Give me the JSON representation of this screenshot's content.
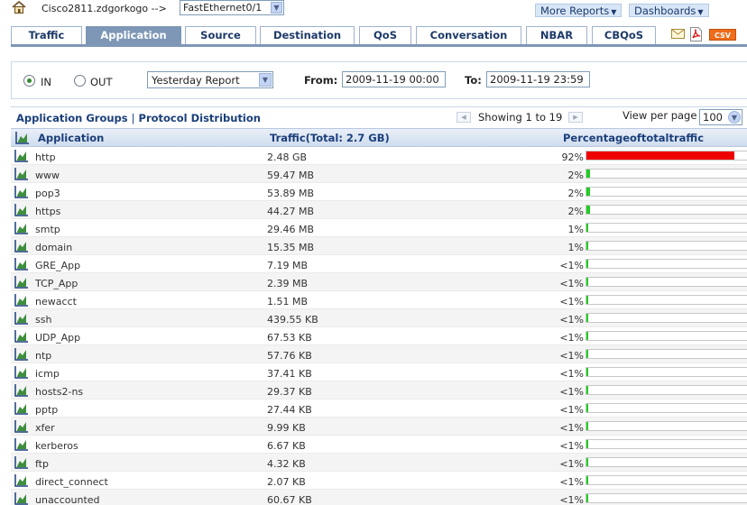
{
  "topbar": {
    "device": "Cisco2811.zdgorkogo -->",
    "interface": "FastEthernet0/1",
    "more_reports": "More Reports",
    "dashboards": "Dashboards"
  },
  "tabs": [
    "Traffic",
    "Application",
    "Source",
    "Destination",
    "QoS",
    "Conversation",
    "NBAR",
    "CBQoS"
  ],
  "active_tab": "Application",
  "export": {
    "csv_label": "CSV"
  },
  "filter": {
    "in_label": "IN",
    "out_label": "OUT",
    "selected_direction": "IN",
    "report": "Yesterday Report",
    "from_label": "From:",
    "from_value": "2009-11-19 00:00",
    "to_label": "To:",
    "to_value": "2009-11-19 23:59"
  },
  "grid": {
    "group_link_1": "Application Groups",
    "group_sep": "|",
    "group_link_2": "Protocol Distribution",
    "showing": "Showing 1 to 19",
    "view_per_page_label": "View per page",
    "view_per_page": "100",
    "col_application": "Application",
    "col_traffic": "Traffic(Total: 2.7 GB)",
    "col_percentage": "Percentageoftotaltraffic"
  },
  "colors": {
    "bar_high": "#ee0000",
    "bar_low": "#22cc22"
  },
  "rows": [
    {
      "app": "http",
      "traffic": "2.48 GB",
      "pct": "92%",
      "fraction": 0.92
    },
    {
      "app": "www",
      "traffic": "59.47 MB",
      "pct": "2%",
      "fraction": 0.02
    },
    {
      "app": "pop3",
      "traffic": "53.89 MB",
      "pct": "2%",
      "fraction": 0.02
    },
    {
      "app": "https",
      "traffic": "44.27 MB",
      "pct": "2%",
      "fraction": 0.02
    },
    {
      "app": "smtp",
      "traffic": "29.46 MB",
      "pct": "1%",
      "fraction": 0.01
    },
    {
      "app": "domain",
      "traffic": "15.35 MB",
      "pct": "1%",
      "fraction": 0.01
    },
    {
      "app": "GRE_App",
      "traffic": "7.19 MB",
      "pct": "<1%",
      "fraction": 0.003
    },
    {
      "app": "TCP_App",
      "traffic": "2.39 MB",
      "pct": "<1%",
      "fraction": 0.001
    },
    {
      "app": "newacct",
      "traffic": "1.51 MB",
      "pct": "<1%",
      "fraction": 0.001
    },
    {
      "app": "ssh",
      "traffic": "439.55 KB",
      "pct": "<1%",
      "fraction": 0.0002
    },
    {
      "app": "UDP_App",
      "traffic": "67.53 KB",
      "pct": "<1%",
      "fraction": 0.0001
    },
    {
      "app": "ntp",
      "traffic": "57.76 KB",
      "pct": "<1%",
      "fraction": 0.0001
    },
    {
      "app": "icmp",
      "traffic": "37.41 KB",
      "pct": "<1%",
      "fraction": 0.0001
    },
    {
      "app": "hosts2-ns",
      "traffic": "29.37 KB",
      "pct": "<1%",
      "fraction": 0.0001
    },
    {
      "app": "pptp",
      "traffic": "27.44 KB",
      "pct": "<1%",
      "fraction": 0.0001
    },
    {
      "app": "xfer",
      "traffic": "9.99 KB",
      "pct": "<1%",
      "fraction": 0.0001
    },
    {
      "app": "kerberos",
      "traffic": "6.67 KB",
      "pct": "<1%",
      "fraction": 0.0001
    },
    {
      "app": "ftp",
      "traffic": "4.32 KB",
      "pct": "<1%",
      "fraction": 0.0001
    },
    {
      "app": "direct_connect",
      "traffic": "2.07 KB",
      "pct": "<1%",
      "fraction": 0.0001
    },
    {
      "app": "unaccounted",
      "traffic": "60.67 KB",
      "pct": "<1%",
      "fraction": 0.0001
    }
  ]
}
